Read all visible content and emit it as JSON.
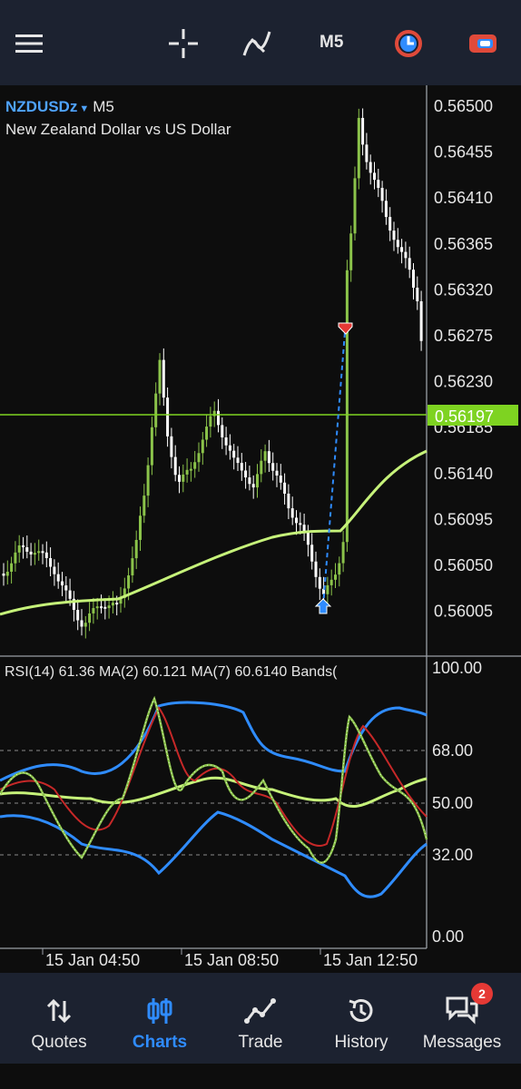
{
  "toolbar": {
    "timeframe": "M5",
    "icons": [
      "menu-icon",
      "crosshair-icon",
      "indicators-icon",
      "timeframe-icon",
      "chart-reset-icon",
      "one-click-trading-icon"
    ]
  },
  "chart_header": {
    "symbol": "NZDUSDz",
    "timeframe": "M5",
    "description": "New Zealand Dollar vs US Dollar"
  },
  "price_axis": {
    "labels": [
      "0.56500",
      "0.56455",
      "0.56410",
      "0.56365",
      "0.56320",
      "0.56275",
      "0.56230",
      "0.56185",
      "0.56140",
      "0.56095",
      "0.56050",
      "0.56005"
    ],
    "current_price": "0.56197",
    "current_price_color": "#7ed321"
  },
  "rsi_panel": {
    "title": "RSI(14) 61.36 MA(2) 60.121 MA(7) 60.6140 Bands(",
    "labels": [
      "100.00",
      "68.00",
      "50.00",
      "32.00",
      "0.00"
    ]
  },
  "time_axis": {
    "labels": [
      "15 Jan 04:50",
      "15 Jan 08:50",
      "15 Jan 12:50"
    ]
  },
  "colors": {
    "candle_up": "#8bc34a",
    "candle_down": "#ffffff",
    "moving_average": "#c6f27a",
    "rsi_bands": "#2f8cff",
    "rsi_ma_fast": "#c62828",
    "accent": "#2f8cff"
  },
  "bottom_nav": {
    "items": [
      {
        "label": "Quotes",
        "icon": "quotes-icon"
      },
      {
        "label": "Charts",
        "icon": "charts-icon"
      },
      {
        "label": "Trade",
        "icon": "trade-icon"
      },
      {
        "label": "History",
        "icon": "history-icon"
      },
      {
        "label": "Messages",
        "icon": "messages-icon"
      }
    ],
    "active": "Charts",
    "messages_badge": "2"
  }
}
